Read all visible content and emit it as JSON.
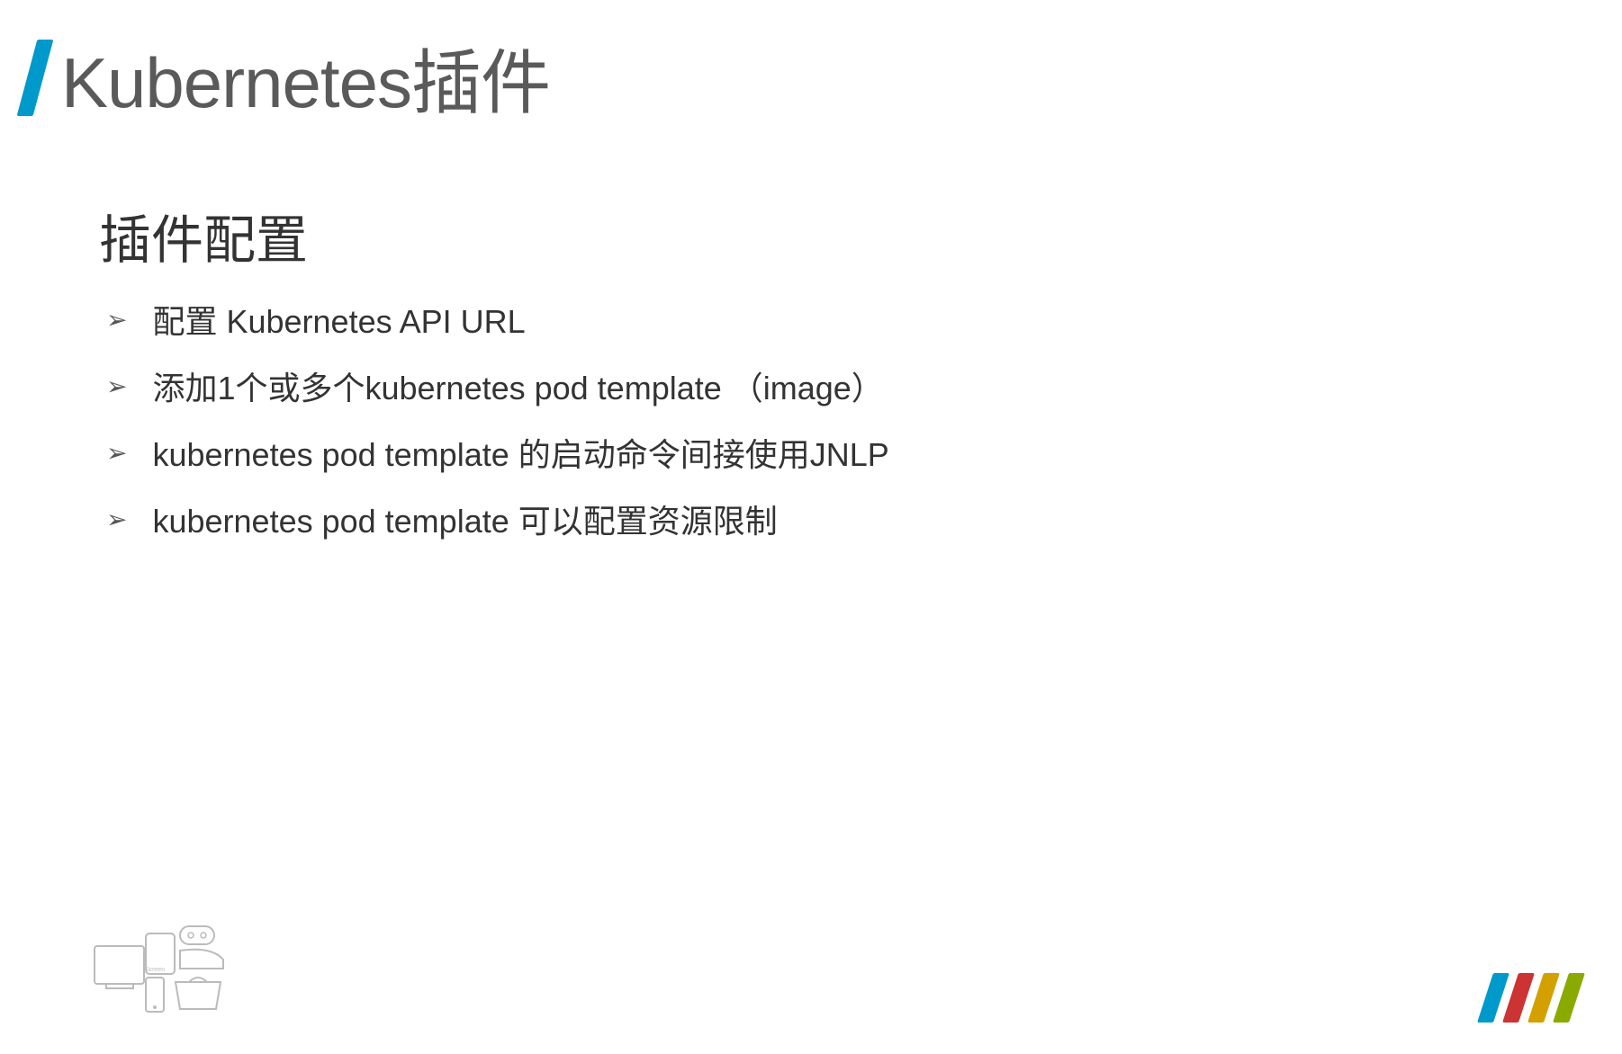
{
  "title": "Kubernetes插件",
  "subtitle": "插件配置",
  "bullets": [
    "配置 Kubernetes API URL",
    "添加1个或多个kubernetes pod template （image）",
    "kubernetes pod template 的启动命令间接使用JNLP",
    "kubernetes pod template 可以配置资源限制"
  ],
  "footerLabel": "Screen"
}
